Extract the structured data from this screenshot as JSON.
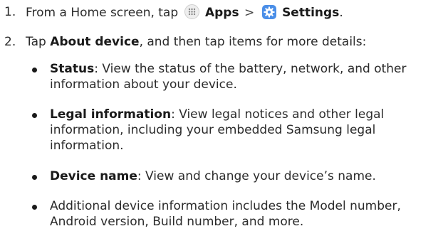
{
  "steps": [
    {
      "number": "1.",
      "prefix": "From a Home screen, tap",
      "apps_label": "Apps",
      "separator": ">",
      "settings_label": "Settings",
      "suffix": ".",
      "apps_icon": "apps-grid-icon",
      "settings_icon": "gear-icon"
    },
    {
      "number": "2.",
      "prefix": "Tap",
      "bold": "About device",
      "suffix": ", and then tap items for more details:"
    }
  ],
  "bullets": [
    {
      "bold": "Status",
      "text": ": View the status of the battery, network, and other information about your device."
    },
    {
      "bold": "Legal information",
      "text": ": View legal notices and other legal information, including your embedded Samsung legal information."
    },
    {
      "bold": "Device name",
      "text": ": View and change your device’s name."
    },
    {
      "bold": "",
      "text": "Additional device information includes the Model number, Android version, Build number, and more."
    }
  ],
  "colors": {
    "text": "#2b2b2b",
    "settings_icon_bg": "#4a8ee8"
  }
}
